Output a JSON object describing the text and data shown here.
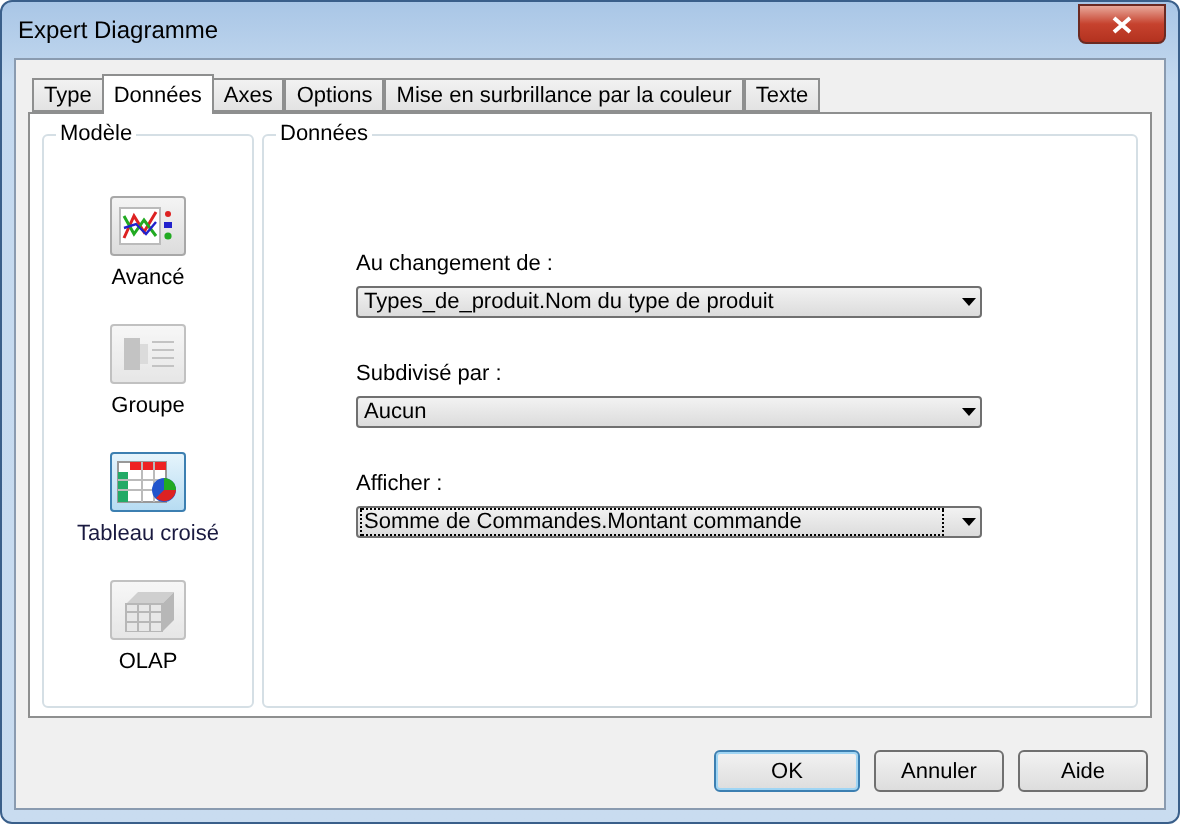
{
  "window": {
    "title": "Expert Diagramme"
  },
  "tabs": [
    {
      "label": "Type",
      "selected": false
    },
    {
      "label": "Données",
      "selected": true
    },
    {
      "label": "Axes",
      "selected": false
    },
    {
      "label": "Options",
      "selected": false
    },
    {
      "label": "Mise en surbrillance par la couleur",
      "selected": false
    },
    {
      "label": "Texte",
      "selected": false
    }
  ],
  "model_group": {
    "title": "Modèle",
    "items": [
      {
        "kind": "advanced",
        "label": "Avancé",
        "selected": false,
        "disabled": false
      },
      {
        "kind": "group",
        "label": "Groupe",
        "selected": false,
        "disabled": true
      },
      {
        "kind": "crosstab",
        "label": "Tableau croisé",
        "selected": true,
        "disabled": false
      },
      {
        "kind": "olap",
        "label": "OLAP",
        "selected": false,
        "disabled": true
      }
    ]
  },
  "data_group": {
    "title": "Données",
    "fields": [
      {
        "label": "Au changement de :",
        "value": "Types_de_produit.Nom du type de produit",
        "focused": false
      },
      {
        "label": "Subdivisé par :",
        "value": "Aucun",
        "focused": false
      },
      {
        "label": "Afficher :",
        "value": "Somme de Commandes.Montant commande",
        "focused": true
      }
    ]
  },
  "buttons": [
    {
      "label": "OK",
      "default": true
    },
    {
      "label": "Annuler",
      "default": false
    },
    {
      "label": "Aide",
      "default": false
    }
  ]
}
